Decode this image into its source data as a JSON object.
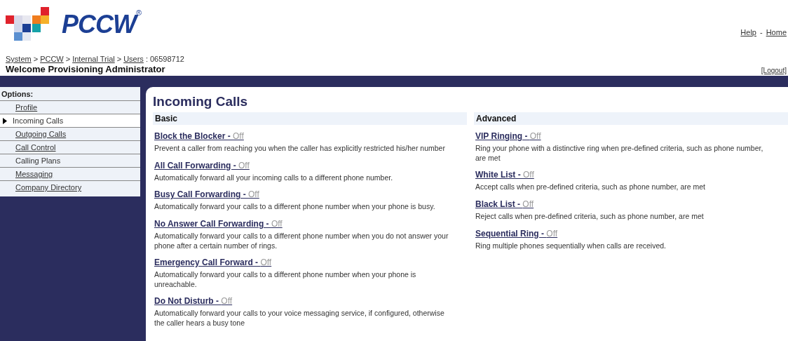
{
  "logo": {
    "text": "PCCW",
    "mark": "®"
  },
  "top_links": [
    {
      "kind": "link",
      "text": "Help"
    },
    {
      "kind": "sep",
      "text": "-"
    },
    {
      "kind": "link",
      "text": "Home"
    }
  ],
  "breadcrumb": [
    {
      "kind": "link",
      "text": "System"
    },
    {
      "kind": "sep",
      "text": ">"
    },
    {
      "kind": "link",
      "text": "PCCW"
    },
    {
      "kind": "sep",
      "text": ">"
    },
    {
      "kind": "link",
      "text": "Internal Trial"
    },
    {
      "kind": "sep",
      "text": ">"
    },
    {
      "kind": "link",
      "text": "Users"
    },
    {
      "kind": "sep",
      "text": ": 06598712"
    }
  ],
  "welcome": "Welcome Provisioning Administrator",
  "logout": "[Logout]",
  "sidebar": {
    "heading": "Options:",
    "items": [
      {
        "label": "Profile",
        "selected": false,
        "link": true
      },
      {
        "label": "Incoming Calls",
        "selected": true,
        "link": false
      },
      {
        "label": "Outgoing Calls",
        "selected": false,
        "link": true
      },
      {
        "label": "Call Control",
        "selected": false,
        "link": true
      },
      {
        "label": "Calling Plans",
        "selected": false,
        "link": false
      },
      {
        "label": "Messaging",
        "selected": false,
        "link": true
      },
      {
        "label": "Company Directory",
        "selected": false,
        "link": true
      }
    ]
  },
  "title": "Incoming Calls",
  "sections": [
    {
      "heading": "Basic",
      "features": [
        {
          "name": "Block the Blocker",
          "sep": " - ",
          "status": "Off",
          "description": "Prevent a caller from reaching you when the caller has explicitly restricted his/her number"
        },
        {
          "name": "All Call Forwarding",
          "sep": " - ",
          "status": "Off",
          "description": "Automatically forward all your incoming calls to a different phone number."
        },
        {
          "name": "Busy Call Forwarding",
          "sep": " - ",
          "status": "Off",
          "description": "Automatically forward your calls to a different phone number when your phone is busy."
        },
        {
          "name": "No Answer Call Forwarding",
          "sep": " - ",
          "status": "Off",
          "description": "Automatically forward your calls to a different phone number when you do not answer your phone after a certain number of rings."
        },
        {
          "name": "Emergency Call Forward",
          "sep": " - ",
          "status": "Off",
          "description": "Automatically forward your calls to a different phone number when your phone is unreachable."
        },
        {
          "name": "Do Not Disturb",
          "sep": " - ",
          "status": "Off",
          "description": "Automatically forward your calls to your voice messaging service, if configured, otherwise the caller hears a busy tone"
        }
      ]
    },
    {
      "heading": "Advanced",
      "features": [
        {
          "name": "VIP Ringing",
          "sep": " - ",
          "status": "Off",
          "description": "Ring your phone with a distinctive ring when pre-defined criteria, such as phone number, are met"
        },
        {
          "name": "White List",
          "sep": " - ",
          "status": "Off",
          "description": "Accept calls when pre-defined criteria, such as phone number, are met"
        },
        {
          "name": "Black List",
          "sep": " - ",
          "status": "Off",
          "description": "Reject calls when pre-defined criteria, such as phone number, are met"
        },
        {
          "name": "Sequential Ring",
          "sep": " - ",
          "status": "Off",
          "description": "Ring multiple phones sequentially when calls are received."
        }
      ]
    }
  ]
}
